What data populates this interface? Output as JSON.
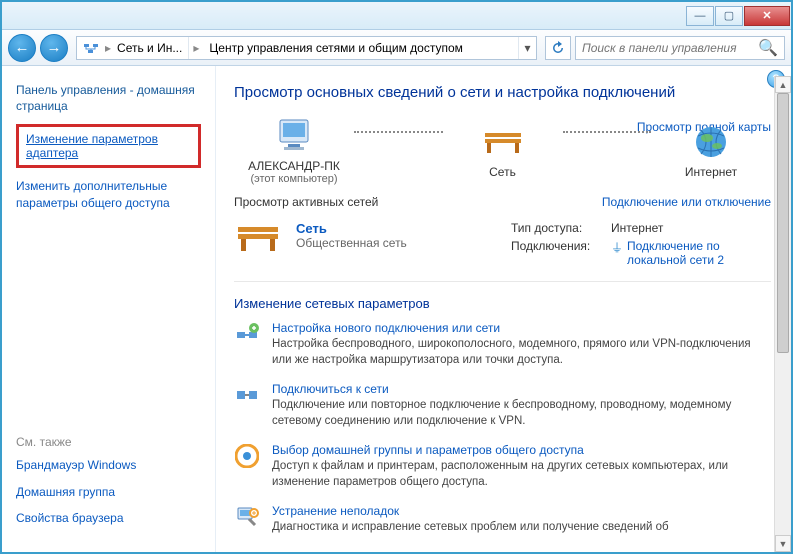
{
  "titlebar": {
    "min": "—",
    "max": "▢",
    "close": "✕"
  },
  "nav": {
    "back": "←",
    "fwd": "→"
  },
  "address": {
    "seg1": "Сеть и Ин...",
    "seg2": "Центр управления сетями и общим доступом"
  },
  "search": {
    "placeholder": "Поиск в панели управления"
  },
  "sidebar": {
    "home": "Панель управления - домашняя страница",
    "adapter": "Изменение параметров адаптера",
    "sharing": "Изменить дополнительные параметры общего доступа",
    "seealso_title": "См. также",
    "seealso": [
      "Брандмауэр Windows",
      "Домашняя группа",
      "Свойства браузера"
    ]
  },
  "main": {
    "heading": "Просмотр основных сведений о сети и настройка подключений",
    "fullmap": "Просмотр полной карты",
    "nodes": {
      "pc": "АЛЕКСАНДР-ПК",
      "pc_sub": "(этот компьютер)",
      "net": "Сеть",
      "inet": "Интернет"
    },
    "active_title": "Просмотр активных сетей",
    "connect_toggle": "Подключение или отключение",
    "netblock": {
      "name": "Сеть",
      "type": "Общественная сеть"
    },
    "kv": {
      "access_k": "Тип доступа:",
      "access_v": "Интернет",
      "conn_k": "Подключения:",
      "conn_v": "Подключение по локальной сети 2"
    },
    "params_title": "Изменение сетевых параметров",
    "tasks": [
      {
        "title": "Настройка нового подключения или сети",
        "desc": "Настройка беспроводного, широкополосного, модемного, прямого или VPN-подключения или же настройка маршрутизатора или точки доступа."
      },
      {
        "title": "Подключиться к сети",
        "desc": "Подключение или повторное подключение к беспроводному, проводному, модемному сетевому соединению или подключение к VPN."
      },
      {
        "title": "Выбор домашней группы и параметров общего доступа",
        "desc": "Доступ к файлам и принтерам, расположенным на других сетевых компьютерах, или изменение параметров общего доступа."
      },
      {
        "title": "Устранение неполадок",
        "desc": "Диагностика и исправление сетевых проблем или получение сведений об"
      }
    ]
  }
}
